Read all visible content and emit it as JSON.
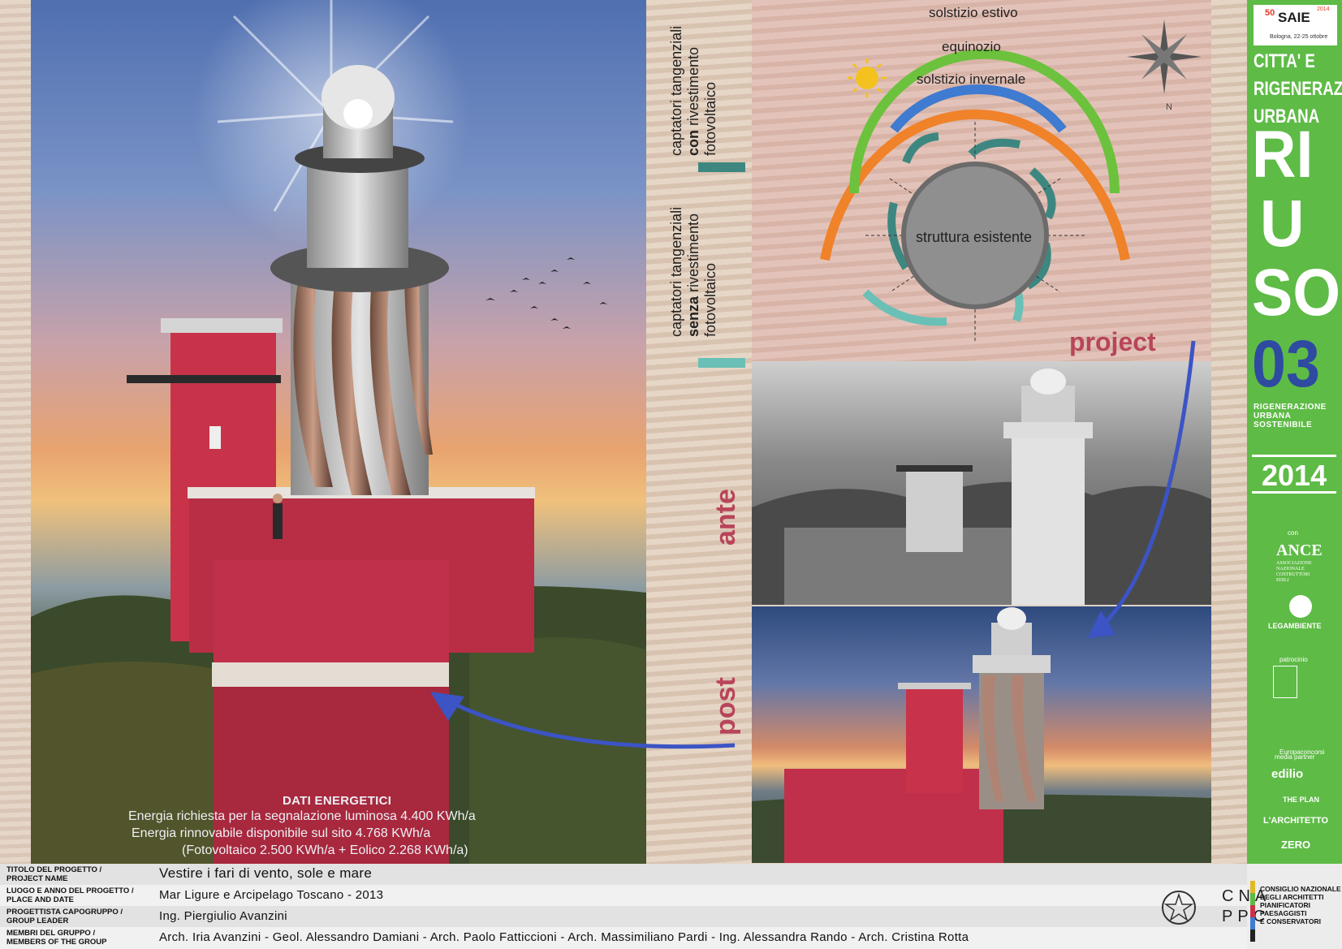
{
  "diagram": {
    "arc_labels": {
      "summer": "solstizio estivo",
      "equinox": "equinozio",
      "winter": "solstizio invernale"
    },
    "center_label": "struttura esistente",
    "north_label": "N",
    "project_label": "project",
    "colors": {
      "summer": "#f0822a",
      "equinox": "#6cc23d",
      "winter": "#3f7bd0",
      "dark_teal": "#3e8781",
      "light_teal": "#6ac0b6",
      "core": "#8f8f8f"
    }
  },
  "legend": {
    "with_pv": {
      "line1": "captatori tangenziali",
      "line2_bold": "con",
      "line2_rest": " rivestimento",
      "line3": "fotovoltaico"
    },
    "without_pv": {
      "line1": "captatori tangenziali",
      "line2_bold": "senza",
      "line2_rest": " rivestimento",
      "line3": "fotovoltaico"
    }
  },
  "photo_labels": {
    "ante": "ante",
    "post": "post"
  },
  "energy": {
    "title": "DATI ENERGETICI",
    "rows": [
      "Energia richiesta per la segnalazione luminosa  4.400 KWh/a",
      "Energia rinnovabile disponibile sul sito              4.768 KWh/a",
      "(Fotovoltaico 2.500 KWh/a + Eolico 2.268 KWh/a)"
    ]
  },
  "sidebar": {
    "saie_logo": "SAIE",
    "saie_badge": "50",
    "saie_year": "2014",
    "saie_sub": "Bologna, 22-25 ottobre",
    "title_lines": [
      "CITTA' E",
      "RIGENERAZIONE",
      "URBANA"
    ],
    "big_letters": [
      "RI",
      "U",
      "SO",
      "03"
    ],
    "subtitle_lines": [
      "RIGENERAZIONE",
      "URBANA",
      "SOSTENIBILE"
    ],
    "year": "2014",
    "con": "con",
    "ance": "ANCE",
    "ance_sub": [
      "ASSOCIAZIONE",
      "NAZIONALE",
      "COSTRUTTORI",
      "EDILI"
    ],
    "legambiente": "LEGAMBIENTE",
    "patrocinio": "patrocinio",
    "media_partner": "media partner",
    "partners": [
      "Europaconcorsi",
      "edilio",
      "THE PLAN",
      "L'ARCHITETTO",
      "ZERO"
    ]
  },
  "footer": {
    "rows": [
      {
        "key": [
          "TITOLO DEL PROGETTO /",
          "PROJECT NAME"
        ],
        "value": "Vestire i fari di vento, sole e mare"
      },
      {
        "key": [
          "LUOGO E ANNO DEL PROGETTO /",
          "PLACE AND DATE"
        ],
        "value": "Mar Ligure e Arcipelago Toscano - 2013"
      },
      {
        "key": [
          "PROGETTISTA CAPOGRUPPO /",
          "GROUP LEADER"
        ],
        "value": "Ing. Piergiulio Avanzini"
      },
      {
        "key": [
          "MEMBRI DEL GRUPPO /",
          "MEMBERS OF THE GROUP"
        ],
        "value": "Arch. Iria Avanzini - Geol. Alessandro Damiani - Arch. Paolo Fatticcioni - Arch. Massimiliano Pardi - Ing. Alessandra Rando - Arch. Cristina Rotta"
      }
    ],
    "cnappc_lines": [
      "CNA",
      "PPC"
    ],
    "council_lines": [
      "CONSIGLIO NAZIONALE",
      "DEGLI ARCHITETTI",
      "PIANIFICATORI",
      "PAESAGGISTI",
      "E CONSERVATORI"
    ]
  }
}
